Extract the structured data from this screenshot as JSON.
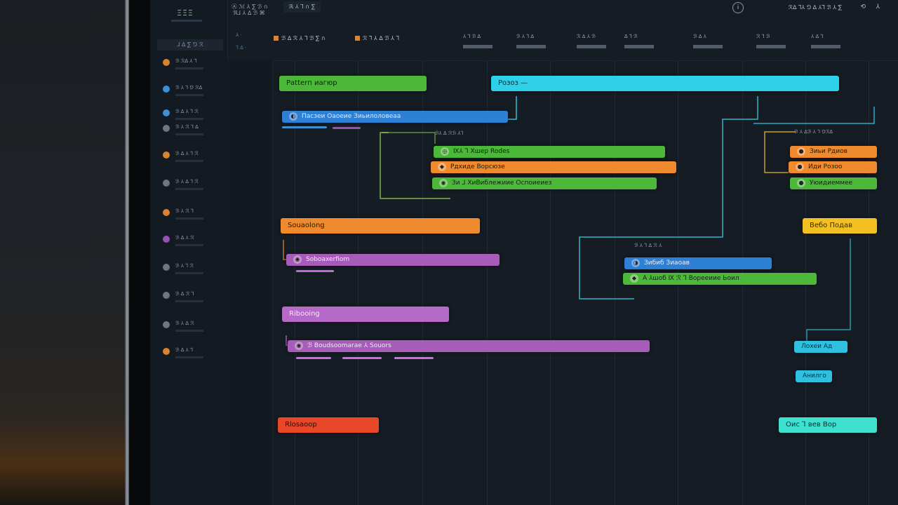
{
  "header": {
    "logo": "ΞΞΞ",
    "crumb_1": "Ⓐ ℳ ⅄ ∑ ℬ ∩",
    "crumb_2": "ℜ⅃ ⅄ ∆ ℬ ⌘",
    "tab": "ℝ ⅄ ⅂ ∩ ∑",
    "account": "ℛ∆ ⅂⅄ ⅁ ∆ ⅄⅂ ℬ ⅄ ∑",
    "help_icon": "i",
    "misc_1": "⟲",
    "misc_2": "⅄"
  },
  "sidebar": {
    "section": "⅃ ∆ ∑ ⅁ ℛ",
    "items": [
      {
        "label": "ℬ ℛ∆ ⅄ ⅂",
        "color": "#d9832e"
      },
      {
        "label": "ℬ ⅄ ⅂ ⅁ ℛ∆",
        "color": "#3d8fd6"
      },
      {
        "label": "ℬ ∆ ⅄ ⅂ ℛ",
        "color": "#3d8fd6"
      },
      {
        "label": "ℬ ⅄ ℛ ⅂ ∆",
        "color": "#6d7782"
      },
      {
        "label": "ℬ ∆ ⅄ ⅂ ℛ",
        "color": "#d9832e"
      },
      {
        "label": "ℬ ⅄ ∆ ⅂ ℛ",
        "color": "#6d7782"
      },
      {
        "label": "ℬ ⅄ ℛ ⅂",
        "color": "#d9832e"
      },
      {
        "label": "ℬ ∆ ⅄ ℛ",
        "color": "#9a4fb8"
      },
      {
        "label": "ℬ ⅄ ⅂ ℛ",
        "color": "#6d7782"
      },
      {
        "label": "ℬ ∆ ℛ ⅂",
        "color": "#6d7782"
      },
      {
        "label": "ℬ ⅄ ∆ ℛ",
        "color": "#6d7782"
      },
      {
        "label": "ℬ ∆ ⅄ ⅂",
        "color": "#d9832e"
      }
    ]
  },
  "timeline": {
    "lane_top": "⅄ ·",
    "lane_top_sub": "⅂ ∆ ·",
    "filters": [
      {
        "label": "ℬ ∆ ℛ ⅄ ⅂ ℬ ∑ ∩"
      },
      {
        "label": "ℛ ⅂ ⅄ ∆ ℬ ⅄ ⅂"
      }
    ],
    "scale": [
      "⅄ ⅂ ℬ ∆",
      "ℬ ⅄ ⅂ ∆",
      "ℛ ∆ ⅄ ℬ",
      "∆ ⅂ ℬ",
      "ℬ ∆ ⅄",
      "ℛ ⅂ ℬ",
      "⅄ ∆ ⅂"
    ],
    "bars": {
      "g1_header": "Раtterп иагюр",
      "g1_child": "Пасзеи Оаоеие  Зиьилоловеаа",
      "g1_note": "ℬ⅄ ∆ ℛℬ ⅄⅂",
      "g1_a": "Ⅸ⅄ ⅂ Хшер Rodes",
      "g1_b": "Рдхиде Ворсюзе",
      "g1_c": "Зи ⅃ ХиВиблежиие Оспоиеиез",
      "right_header": "Розоз —",
      "r1_note": "ℬ ⅄ ∆ℬ ⅄ ⅂ ⅁ℛ∆",
      "r1_a": "Зиьи Рдиов",
      "r1_b": "Иди Розоо",
      "r1_c": "Уюидиеммее",
      "g2_header": "Souaolong",
      "g2_child": "Soboaxerfiom",
      "mid_note": "ℬ ⅄ ⅂ ∆ ℛ ⅄",
      "mid_a": "Зибиб Зиаоав",
      "mid_b": "А ⅄шоб Ⅸ ℛ ⅂ Ворееиие Ьоил",
      "yellow": "Вебо Подав",
      "g3_header": "Ribooing",
      "g3_child": "ℬ Boudsoomarae ⅄ Souors",
      "cyan_a": "Лохеи Ад",
      "cyan_b": "Анилго",
      "g4_header": "Rlosaoop",
      "teal": "Оис ⅂ вев Вор"
    }
  },
  "colors": {
    "green": "#4cb83a",
    "cyan": "#2fd0ea",
    "blue": "#2e7fd6",
    "orange": "#f08a2e",
    "purple": "#a65cb8",
    "yellow": "#f2c020",
    "red": "#e8472a",
    "teal": "#3ee0d0"
  }
}
